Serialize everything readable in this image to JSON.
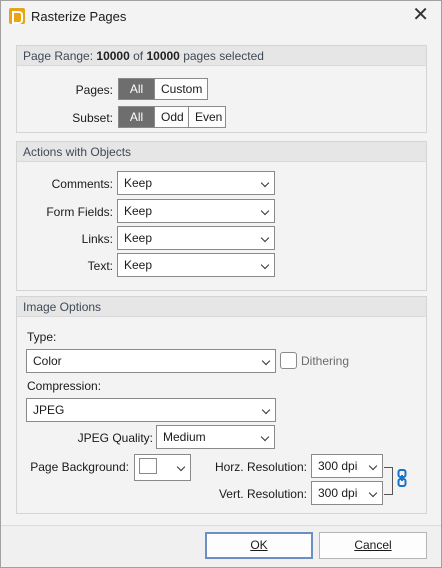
{
  "window": {
    "title": "Rasterize Pages"
  },
  "page_range": {
    "header_prefix": "Page Range:",
    "selected_count": "10000",
    "of_text": "of",
    "total_count": "10000",
    "suffix": "pages selected",
    "pages_label": "Pages:",
    "pages_options": [
      "All",
      "Custom"
    ],
    "pages_selected": "All",
    "subset_label": "Subset:",
    "subset_options": [
      "All",
      "Odd",
      "Even"
    ],
    "subset_selected": "All"
  },
  "actions": {
    "header": "Actions with Objects",
    "comments_label": "Comments:",
    "comments_value": "Keep",
    "form_fields_label": "Form Fields:",
    "form_fields_value": "Keep",
    "links_label": "Links:",
    "links_value": "Keep",
    "text_label": "Text:",
    "text_value": "Keep"
  },
  "image_options": {
    "header": "Image Options",
    "type_label": "Type:",
    "type_value": "Color",
    "dithering_label": "Dithering",
    "compression_label": "Compression:",
    "compression_value": "JPEG",
    "jpeg_quality_label": "JPEG Quality:",
    "jpeg_quality_value": "Medium",
    "page_background_label": "Page Background:",
    "page_background_color": "#ffffff",
    "horz_resolution_label": "Horz. Resolution:",
    "horz_resolution_value": "300 dpi",
    "vert_resolution_label": "Vert. Resolution:",
    "vert_resolution_value": "300 dpi"
  },
  "buttons": {
    "ok": "OK",
    "cancel": "Cancel"
  },
  "colors": {
    "accent": "#1a73c6",
    "selected_segment": "#6e6e6e",
    "app_icon": "#e8a317"
  }
}
